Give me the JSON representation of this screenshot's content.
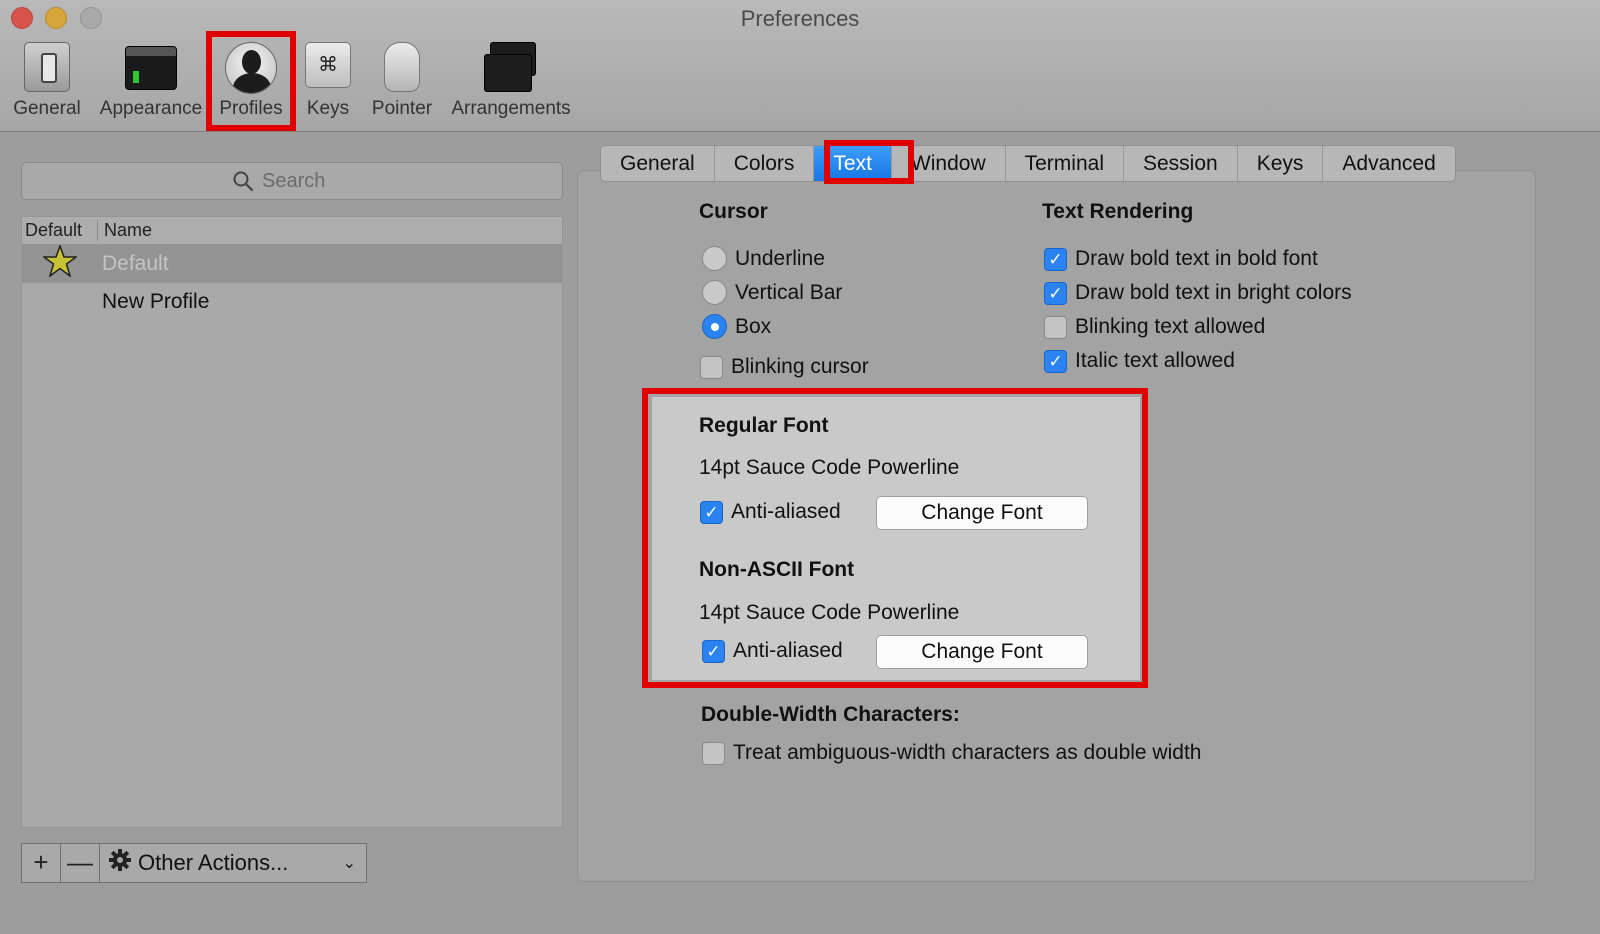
{
  "window": {
    "title": "Preferences"
  },
  "toolbar": {
    "items": [
      {
        "label": "General",
        "icon": "general-toggle-icon"
      },
      {
        "label": "Appearance",
        "icon": "appearance-terminal-icon"
      },
      {
        "label": "Profiles",
        "icon": "profile-person-icon"
      },
      {
        "label": "Keys",
        "icon": "command-key-icon"
      },
      {
        "label": "Pointer",
        "icon": "mouse-icon"
      },
      {
        "label": "Arrangements",
        "icon": "window-arrangement-icon"
      }
    ]
  },
  "sidebar": {
    "search_placeholder": "Search",
    "columns": {
      "default": "Default",
      "name": "Name"
    },
    "profiles": [
      {
        "name": "Default",
        "is_default": true
      },
      {
        "name": "New Profile",
        "is_default": false
      }
    ],
    "add_symbol": "+",
    "remove_symbol": "—",
    "other_actions": "Other Actions...",
    "caret": "⌄"
  },
  "tabs": [
    "General",
    "Colors",
    "Text",
    "Window",
    "Terminal",
    "Session",
    "Keys",
    "Advanced"
  ],
  "cursor": {
    "title": "Cursor",
    "options": [
      "Underline",
      "Vertical Bar",
      "Box"
    ],
    "selected": "Box",
    "blinking_label": "Blinking cursor",
    "blinking_checked": false
  },
  "rendering": {
    "title": "Text Rendering",
    "options": [
      {
        "label": "Draw bold text in bold font",
        "checked": true
      },
      {
        "label": "Draw bold text in bright colors",
        "checked": true
      },
      {
        "label": "Blinking text allowed",
        "checked": false
      },
      {
        "label": "Italic text allowed",
        "checked": true
      }
    ]
  },
  "regular_font": {
    "title": "Regular Font",
    "value": "14pt Sauce Code Powerline",
    "anti_aliased_label": "Anti-aliased",
    "anti_aliased": true,
    "button": "Change Font"
  },
  "non_ascii_font": {
    "title": "Non-ASCII Font",
    "value": "14pt Sauce Code Powerline",
    "anti_aliased_label": "Anti-aliased",
    "anti_aliased": true,
    "button": "Change Font"
  },
  "double_width": {
    "title": "Double-Width Characters:",
    "label": "Treat ambiguous-width characters as double width",
    "checked": false
  },
  "check_glyph": "✓",
  "colors": {
    "accent": "#2a83f1",
    "highlight": "#e00000"
  }
}
